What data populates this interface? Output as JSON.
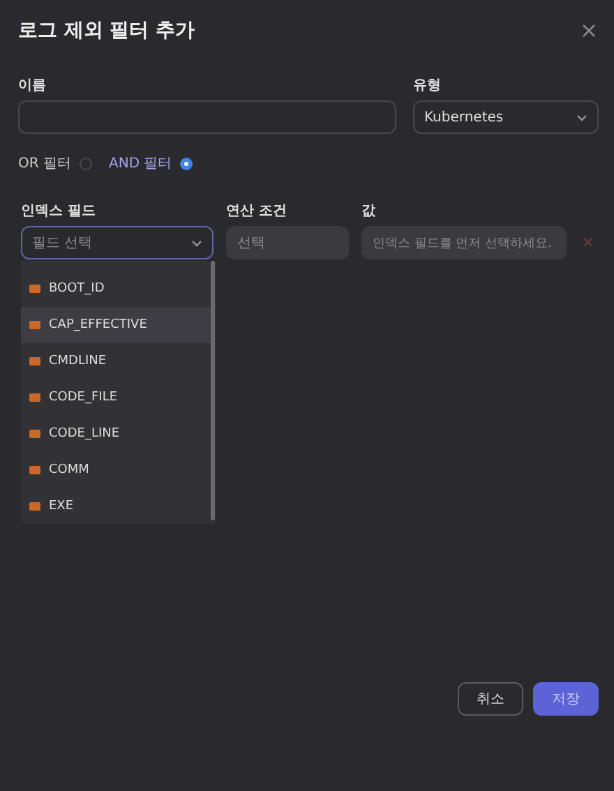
{
  "dialog": {
    "title": "로그 제외 필터 추가"
  },
  "name_field": {
    "label": "이름"
  },
  "type_field": {
    "label": "유형",
    "value": "Kubernetes"
  },
  "filter_modes": [
    {
      "label": "OR 필터",
      "selected": false
    },
    {
      "label": "AND 필터",
      "selected": true
    }
  ],
  "condition": {
    "field_label": "인덱스 필드",
    "field_placeholder": "필드 선택",
    "operator_label": "연산 조건",
    "operator_placeholder": "선택",
    "value_label": "값",
    "value_placeholder": "인덱스 필드를 먼저 선택하세요."
  },
  "field_options": [
    {
      "label": "BOOT_ID",
      "selected": false
    },
    {
      "label": "CAP_EFFECTIVE",
      "selected": true
    },
    {
      "label": "CMDLINE",
      "selected": false
    },
    {
      "label": "CODE_FILE",
      "selected": false
    },
    {
      "label": "CODE_LINE",
      "selected": false
    },
    {
      "label": "COMM",
      "selected": false
    },
    {
      "label": "EXE",
      "selected": false
    }
  ],
  "buttons": [
    {
      "label": "취소",
      "kind": "secondary"
    },
    {
      "label": "저장",
      "kind": "primary"
    }
  ]
}
